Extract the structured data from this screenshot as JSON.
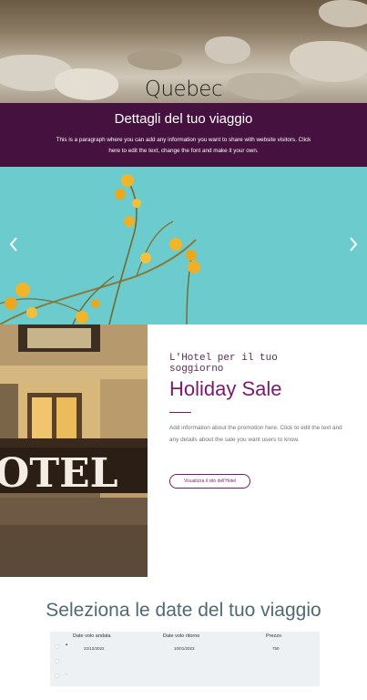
{
  "hero": {
    "city": "Quebec"
  },
  "band": {
    "title": "Dettagli del tuo viaggio",
    "paragraph": "This is a paragraph where you can add any information you want to share with website visitors. Click here to edit the text, change the font and make it your own."
  },
  "slideshow": {
    "prev_icon": "chevron-left",
    "next_icon": "chevron-right"
  },
  "promo": {
    "eyebrow": "L'Hotel per il tuo soggiorno",
    "title": "Holiday Sale",
    "description": "Add information about the promotion here. Click to edit the text and any details about the sale you want users to know.",
    "button": "Visualizza il sito dell'Hotel"
  },
  "dates": {
    "title": "Seleziona le date del tuo viaggio",
    "headers": [
      "Date volo andata",
      "Date volo ritorno",
      "Prezzo"
    ],
    "rows": [
      [
        "22/12/2022",
        "10/01/2023",
        "750"
      ]
    ]
  },
  "colors": {
    "accent": "#7a1a6e",
    "band": "#45123f"
  }
}
